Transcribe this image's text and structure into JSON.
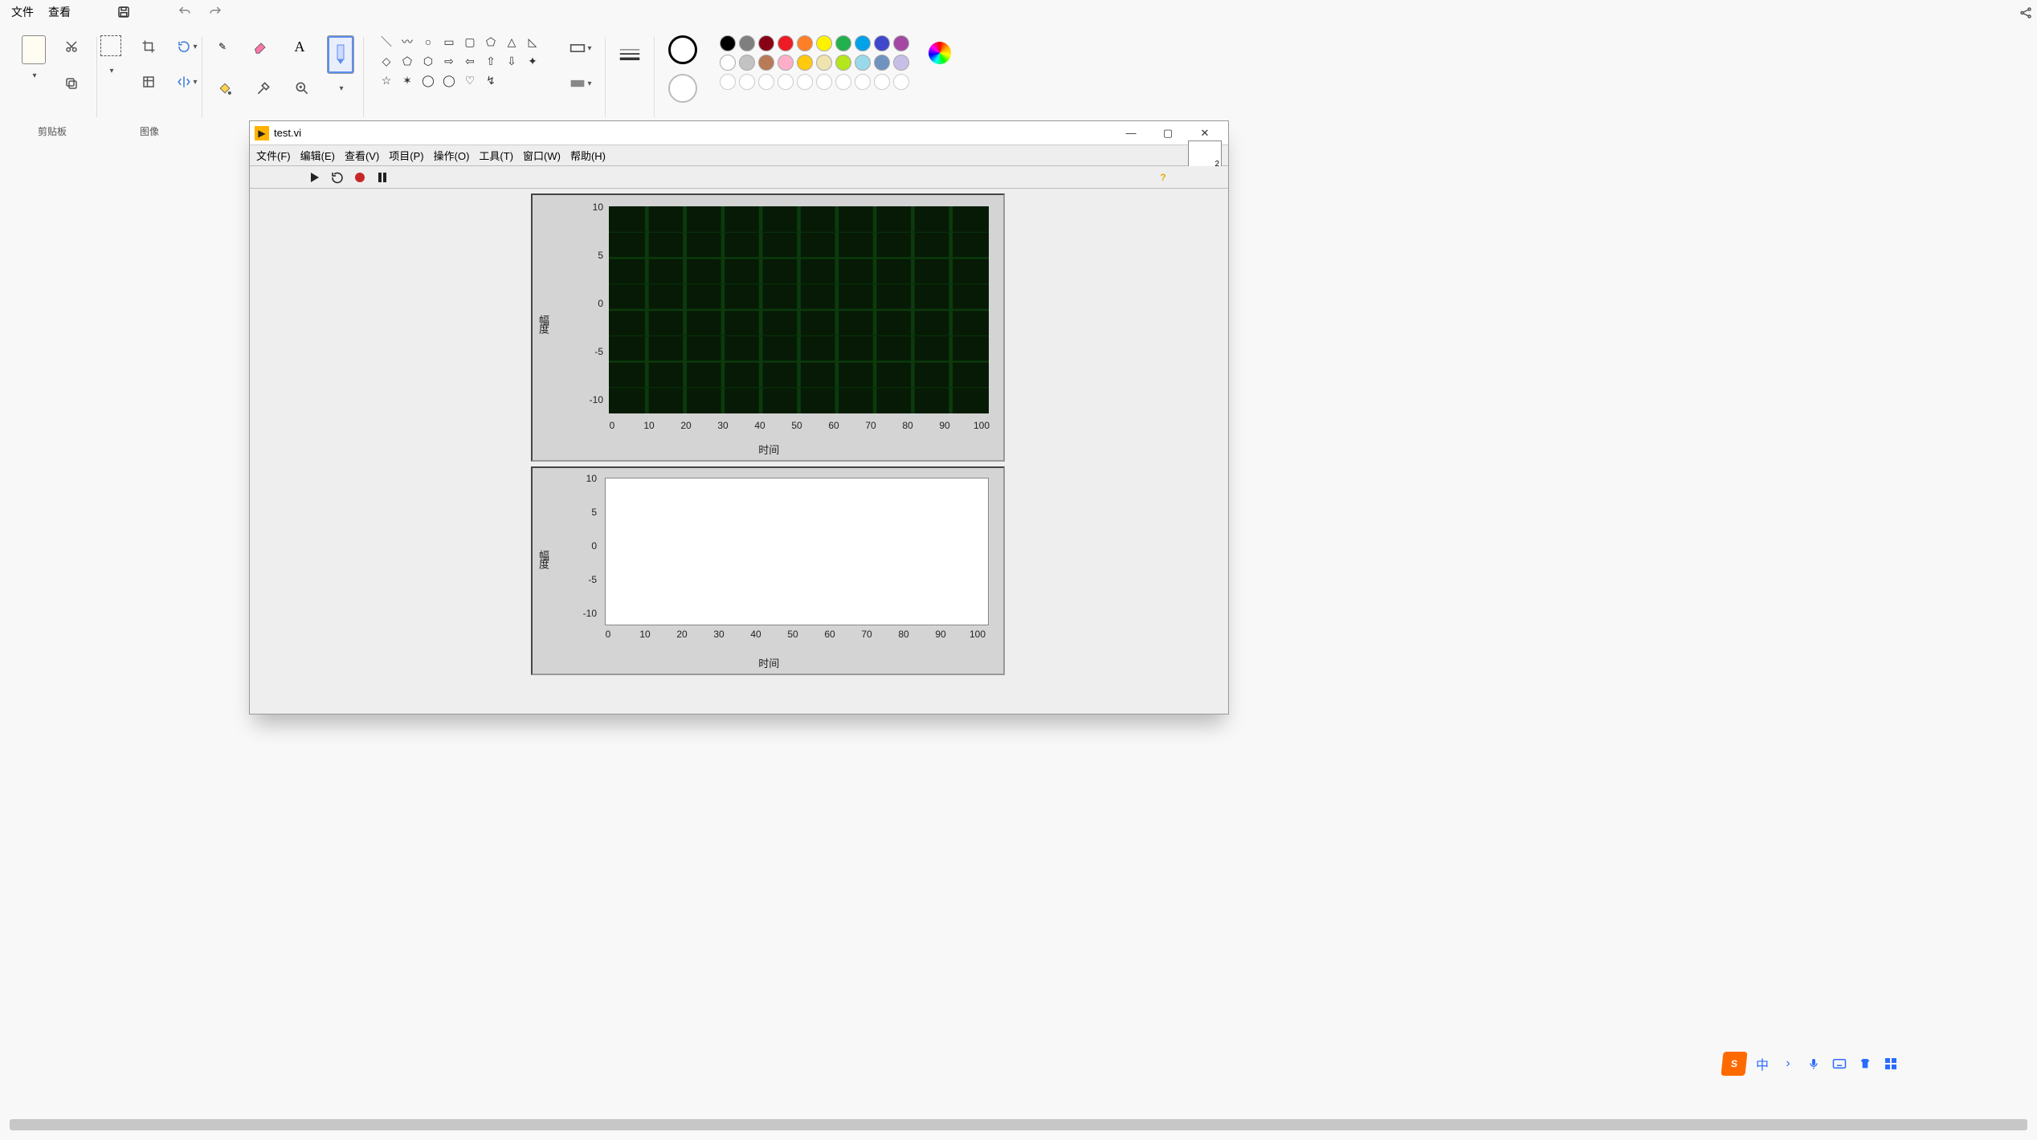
{
  "app_menu": {
    "file": "文件",
    "view": "查看"
  },
  "ribbon": {
    "clipboard_label": "剪贴板",
    "image_label": "图像"
  },
  "palette_colors_row1": [
    "#000000",
    "#7f7f7f",
    "#880015",
    "#ed1c24",
    "#ff7f27",
    "#fff200",
    "#22b14c",
    "#00a2e8",
    "#3f48cc",
    "#a349a4"
  ],
  "palette_colors_row2": [
    "#ffffff",
    "#c3c3c3",
    "#b97a57",
    "#ffaec9",
    "#ffc90e",
    "#efe4b0",
    "#b5e61d",
    "#99d9ea",
    "#7092be",
    "#c8bfe7"
  ],
  "labview": {
    "title": "test.vi",
    "menus": {
      "file": "文件(F)",
      "edit": "编辑(E)",
      "view": "查看(V)",
      "project": "项目(P)",
      "operate": "操作(O)",
      "tools": "工具(T)",
      "window": "窗口(W)",
      "help": "帮助(H)"
    },
    "vi_icon_badge": "2"
  },
  "ime": {
    "lang": "中"
  },
  "chart_data": [
    {
      "id": "scope_chart",
      "type": "line",
      "title": "",
      "xlabel": "时间",
      "ylabel": "幅度",
      "xlim": [
        0,
        100
      ],
      "ylim": [
        -10,
        10
      ],
      "xticks": [
        0,
        10,
        20,
        30,
        40,
        50,
        60,
        70,
        80,
        90,
        100
      ],
      "yticks": [
        -10,
        -5,
        0,
        5,
        10
      ],
      "background": "dark-green-grid",
      "series": []
    },
    {
      "id": "white_chart",
      "type": "line",
      "title": "",
      "xlabel": "时间",
      "ylabel": "幅度",
      "xlim": [
        0,
        100
      ],
      "ylim": [
        -10,
        10
      ],
      "xticks": [
        0,
        10,
        20,
        30,
        40,
        50,
        60,
        70,
        80,
        90,
        100
      ],
      "yticks": [
        -10,
        -5,
        0,
        5,
        10
      ],
      "background": "white",
      "series": []
    }
  ]
}
